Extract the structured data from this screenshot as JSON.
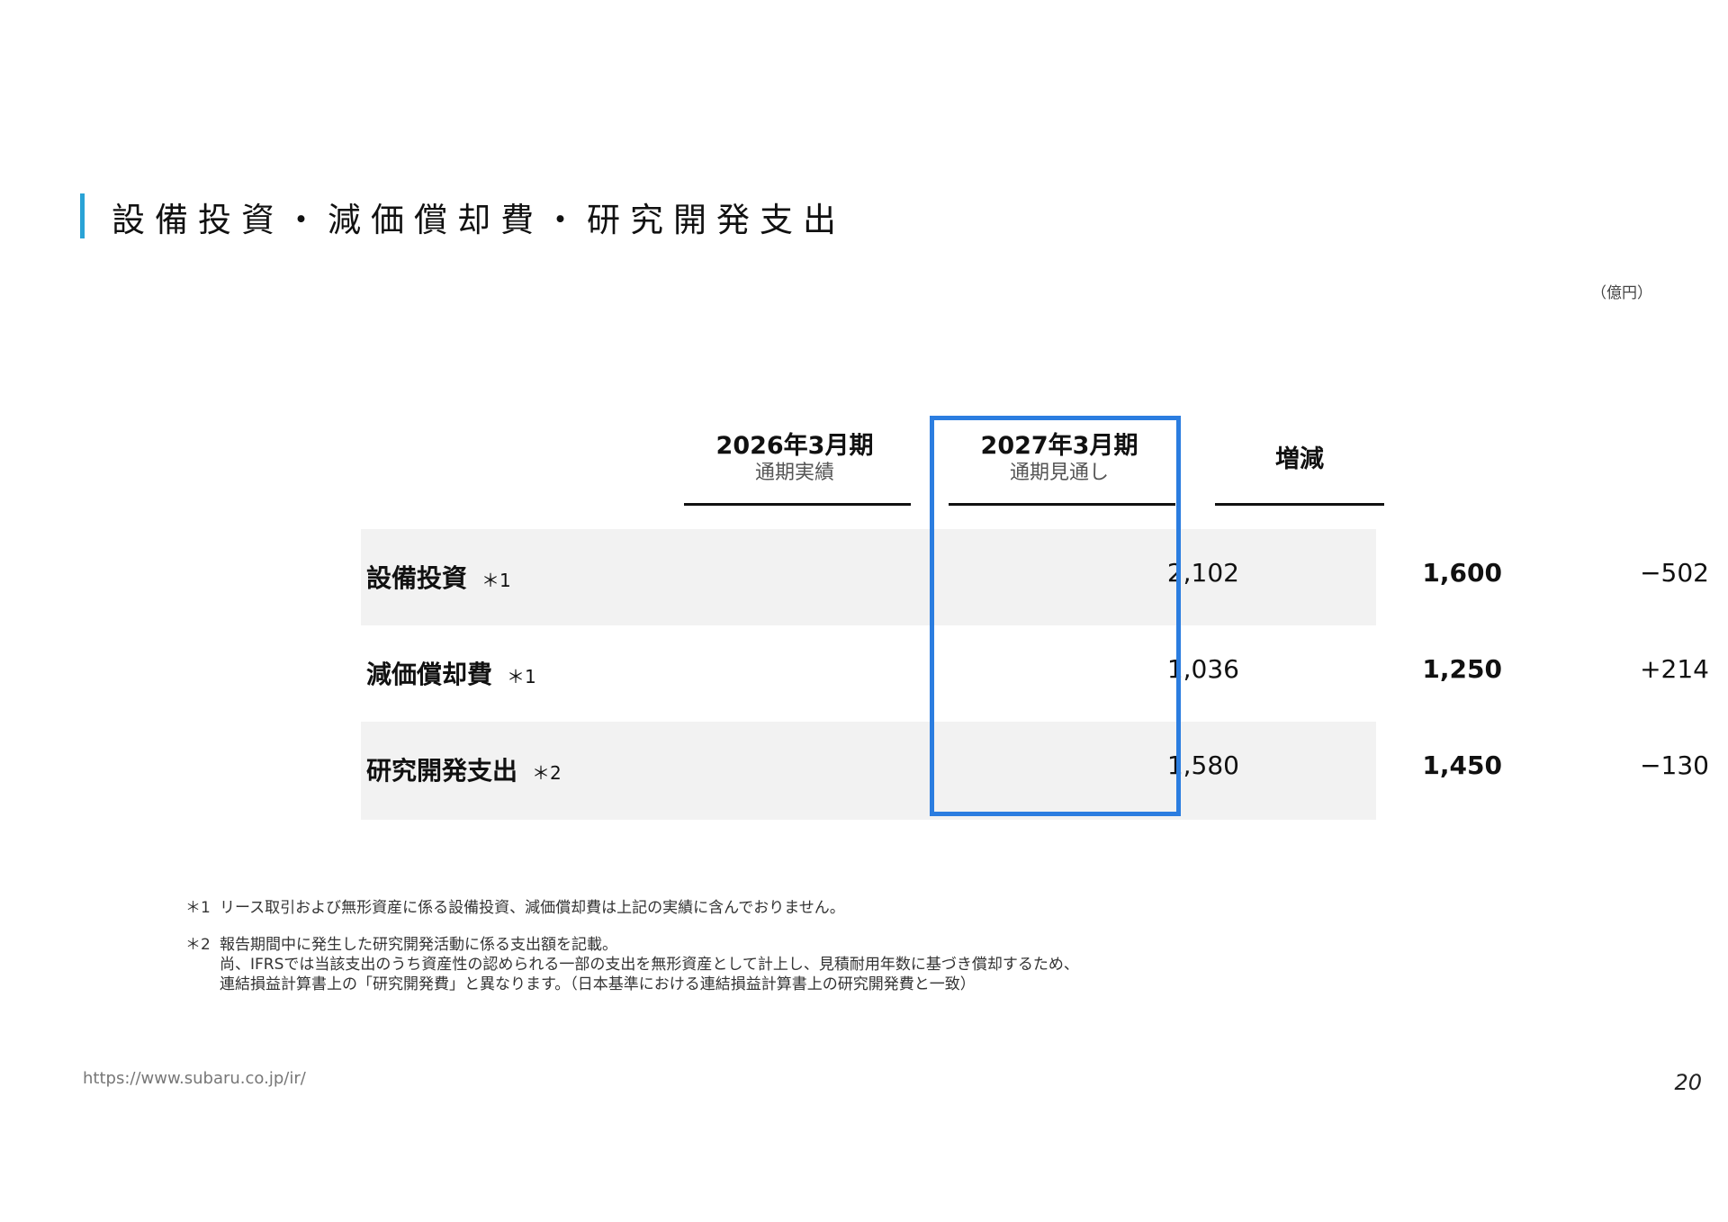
{
  "title": "設備投資・減価償却費・研究開発支出",
  "unit": "（億円）",
  "columns": [
    {
      "line1": "2026年3月期",
      "line2": "通期実績"
    },
    {
      "line1": "2027年3月期",
      "line2": "通期見通し"
    },
    {
      "line1": "増減",
      "line2": ""
    }
  ],
  "rows": [
    {
      "label": "設備投資",
      "note": "＊1",
      "actual": "2,102",
      "forecast": "1,600",
      "change": "−502"
    },
    {
      "label": "減価償却費",
      "note": "＊1",
      "actual": "1,036",
      "forecast": "1,250",
      "change": "+214"
    },
    {
      "label": "研究開発支出",
      "note": "＊2",
      "actual": "1,580",
      "forecast": "1,450",
      "change": "−130"
    }
  ],
  "footnotes": [
    {
      "mark": "＊1",
      "lines": [
        "リース取引および無形資産に係る設備投資、減価償却費は上記の実績に含んでおりません。"
      ]
    },
    {
      "mark": "＊2",
      "lines": [
        "報告期間中に発生した研究開発活動に係る支出額を記載。",
        "尚、IFRSでは当該支出のうち資産性の認められる一部の支出を無形資産として計上し、見積耐用年数に基づき償却するため、",
        "連結損益計算書上の「研究開発費」と異なります。（日本基準における連結損益計算書上の研究開発費と一致）"
      ]
    }
  ],
  "url": "https://www.subaru.co.jp/ir/",
  "page_number": "20",
  "colors": {
    "accent_bar": "#2aa3d6",
    "highlight_border": "#2b7de0",
    "row_shade": "#f2f2f2"
  }
}
